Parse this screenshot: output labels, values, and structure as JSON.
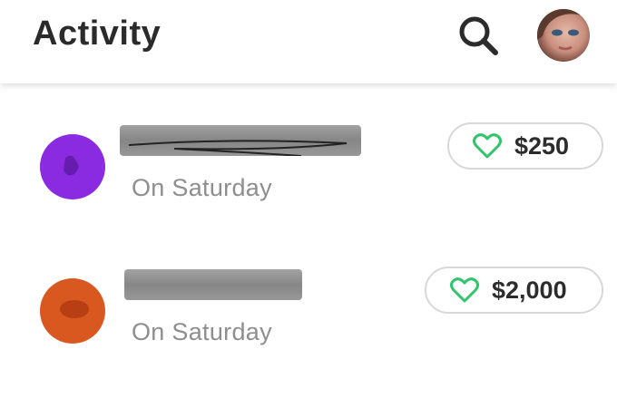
{
  "header": {
    "title": "Activity"
  },
  "colors": {
    "accent_green": "#2ec56b",
    "avatar_purple": "#8a2be2",
    "avatar_orange": "#d9581f"
  },
  "activity": [
    {
      "subtitle": "On Saturday",
      "amount": "$250",
      "avatar_color": "#8a2be2",
      "icon": "heart-icon"
    },
    {
      "subtitle": "On Saturday",
      "amount": "$2,000",
      "avatar_color": "#d9581f",
      "icon": "heart-icon"
    }
  ]
}
